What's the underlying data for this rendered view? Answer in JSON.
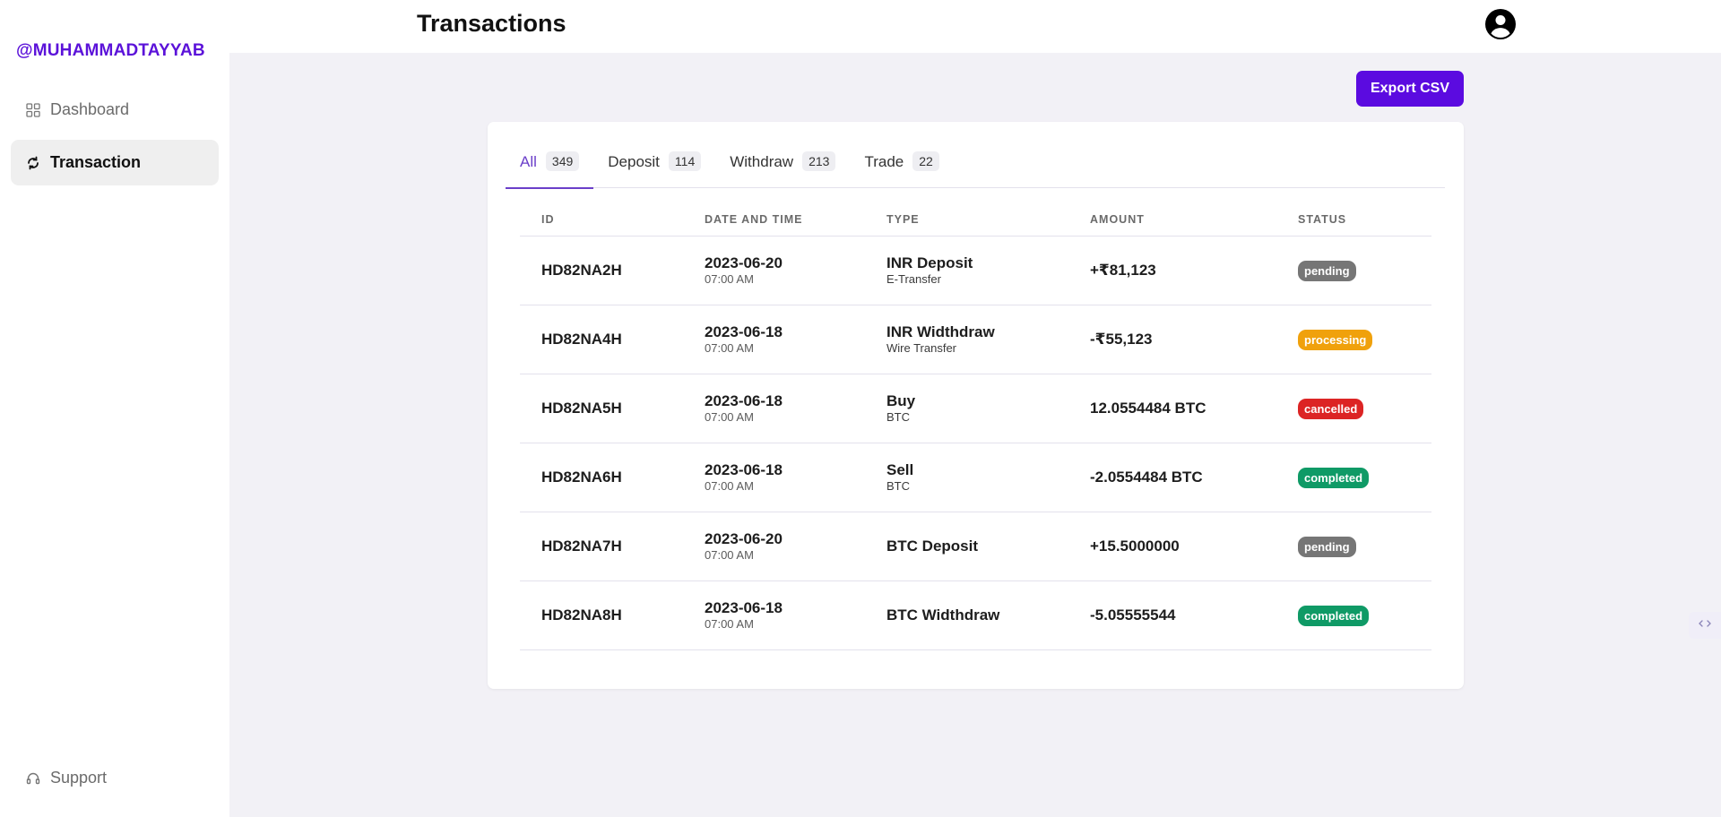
{
  "brand": "@MUHAMMADTAYYAB",
  "page_title": "Transactions",
  "sidebar": {
    "items": [
      {
        "label": "Dashboard",
        "icon": "grid-icon"
      },
      {
        "label": "Transaction",
        "icon": "refresh-icon",
        "active": true
      }
    ],
    "support_label": "Support"
  },
  "export_label": "Export CSV",
  "tabs": [
    {
      "label": "All",
      "count": "349"
    },
    {
      "label": "Deposit",
      "count": "114"
    },
    {
      "label": "Withdraw",
      "count": "213"
    },
    {
      "label": "Trade",
      "count": "22"
    }
  ],
  "table": {
    "headers": [
      "ID",
      "DATE AND TIME",
      "TYPE",
      "AMOUNT",
      "STATUS"
    ],
    "rows": [
      {
        "id": "HD82NA2H",
        "date": "2023-06-20",
        "time": "07:00 AM",
        "type": "INR Deposit",
        "subtype": "E-Transfer",
        "amount": "+₹81,123",
        "status": "pending"
      },
      {
        "id": "HD82NA4H",
        "date": "2023-06-18",
        "time": "07:00 AM",
        "type": "INR Widthdraw",
        "subtype": "Wire Transfer",
        "amount": "-₹55,123",
        "status": "processing"
      },
      {
        "id": "HD82NA5H",
        "date": "2023-06-18",
        "time": "07:00 AM",
        "type": "Buy",
        "subtype": "BTC",
        "amount": "12.0554484 BTC",
        "status": "cancelled"
      },
      {
        "id": "HD82NA6H",
        "date": "2023-06-18",
        "time": "07:00 AM",
        "type": "Sell",
        "subtype": "BTC",
        "amount": "-2.0554484 BTC",
        "status": "completed"
      },
      {
        "id": "HD82NA7H",
        "date": "2023-06-20",
        "time": "07:00 AM",
        "type": "BTC Deposit",
        "subtype": "",
        "amount": "+15.5000000",
        "status": "pending"
      },
      {
        "id": "HD82NA8H",
        "date": "2023-06-18",
        "time": "07:00 AM",
        "type": "BTC Widthdraw",
        "subtype": "",
        "amount": "-5.05555544",
        "status": "completed"
      }
    ]
  },
  "colors": {
    "brand": "#5b12d9",
    "accent": "#5b0be0",
    "tab_active": "#6b3fc9",
    "pending": "#767676",
    "processing": "#f0a10c",
    "cancelled": "#dc2424",
    "completed": "#0f9a66"
  }
}
